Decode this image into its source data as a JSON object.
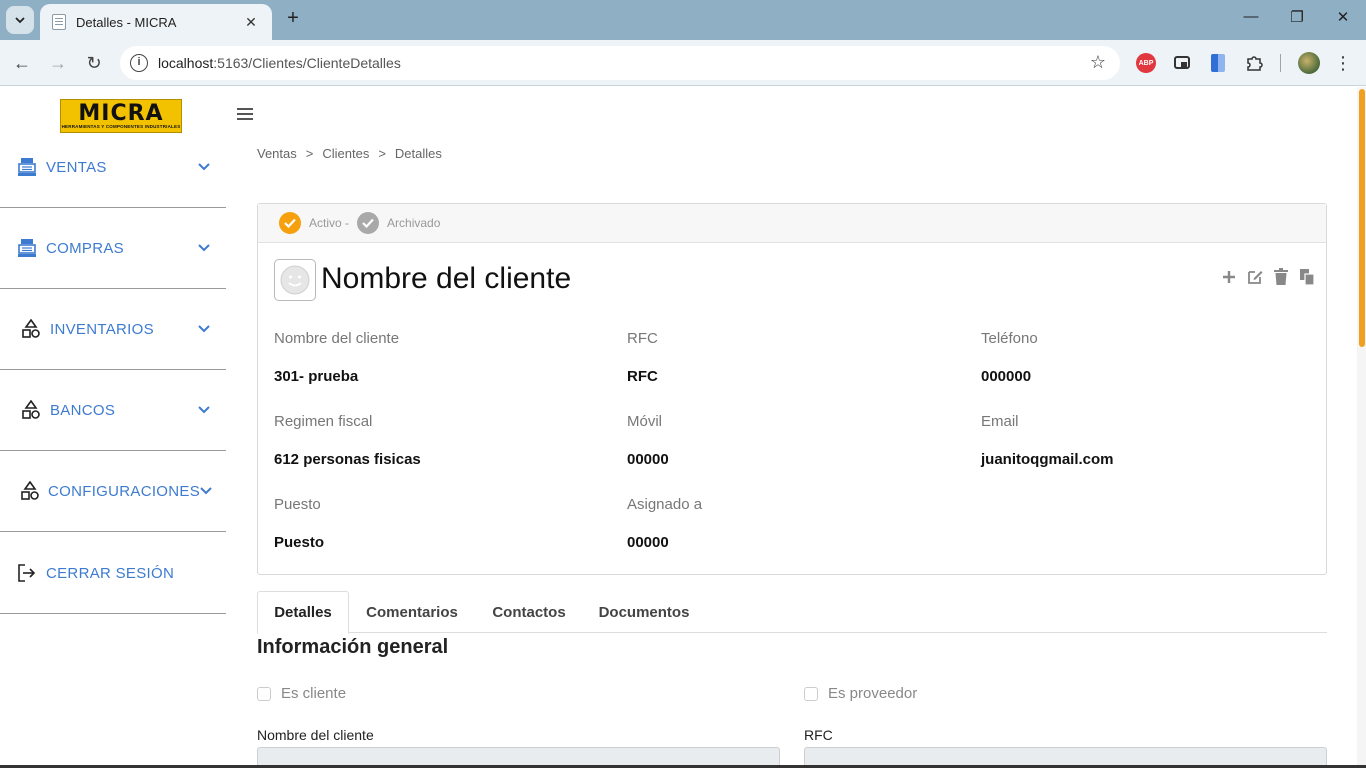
{
  "browser": {
    "tab_title": "Detalles - MICRA",
    "url_host": "localhost",
    "url_path": ":5163/Clientes/ClienteDetalles",
    "abp_label": "ABP"
  },
  "sidebar": {
    "logo_brand": "MICRA",
    "logo_tagline": "HERRAMIENTAS Y COMPONENTES INDUSTRIALES",
    "items": [
      {
        "label": "VENTAS",
        "icon": "cash-register-icon"
      },
      {
        "label": "COMPRAS",
        "icon": "cash-register-icon"
      },
      {
        "label": "INVENTARIOS",
        "icon": "shapes-icon"
      },
      {
        "label": "BANCOS",
        "icon": "shapes-icon"
      },
      {
        "label": "CONFIGURACIONES",
        "icon": "shapes-icon"
      },
      {
        "label": "CERRAR SESIÓN",
        "icon": "logout-icon"
      }
    ]
  },
  "breadcrumb": {
    "items": [
      "Ventas",
      "Clientes",
      "Detalles"
    ],
    "separator": ">"
  },
  "status": {
    "active_label": "Activo -",
    "archived_label": "Archivado"
  },
  "client": {
    "title": "Nombre del cliente",
    "fields": [
      {
        "label": "Nombre del cliente",
        "value": "301- prueba"
      },
      {
        "label": "RFC",
        "value": "RFC"
      },
      {
        "label": "Teléfono",
        "value": "000000"
      },
      {
        "label": "Regimen fiscal",
        "value": "612 personas fisicas"
      },
      {
        "label": "Móvil",
        "value": "00000"
      },
      {
        "label": "Email",
        "value": "juanitoqgmail.com"
      },
      {
        "label": "Puesto",
        "value": "Puesto"
      },
      {
        "label": "Asignado a",
        "value": "00000"
      }
    ]
  },
  "tabs": [
    "Detalles",
    "Comentarios",
    "Contactos",
    "Documentos"
  ],
  "general": {
    "title": "Información general",
    "checkbox_cliente": "Es cliente",
    "checkbox_proveedor": "Es proveedor",
    "label_nombre": "Nombre del cliente",
    "label_rfc": "RFC"
  },
  "colors": {
    "accent": "#f5a00c",
    "link": "#3d7bd1",
    "logo": "#f2c200"
  }
}
